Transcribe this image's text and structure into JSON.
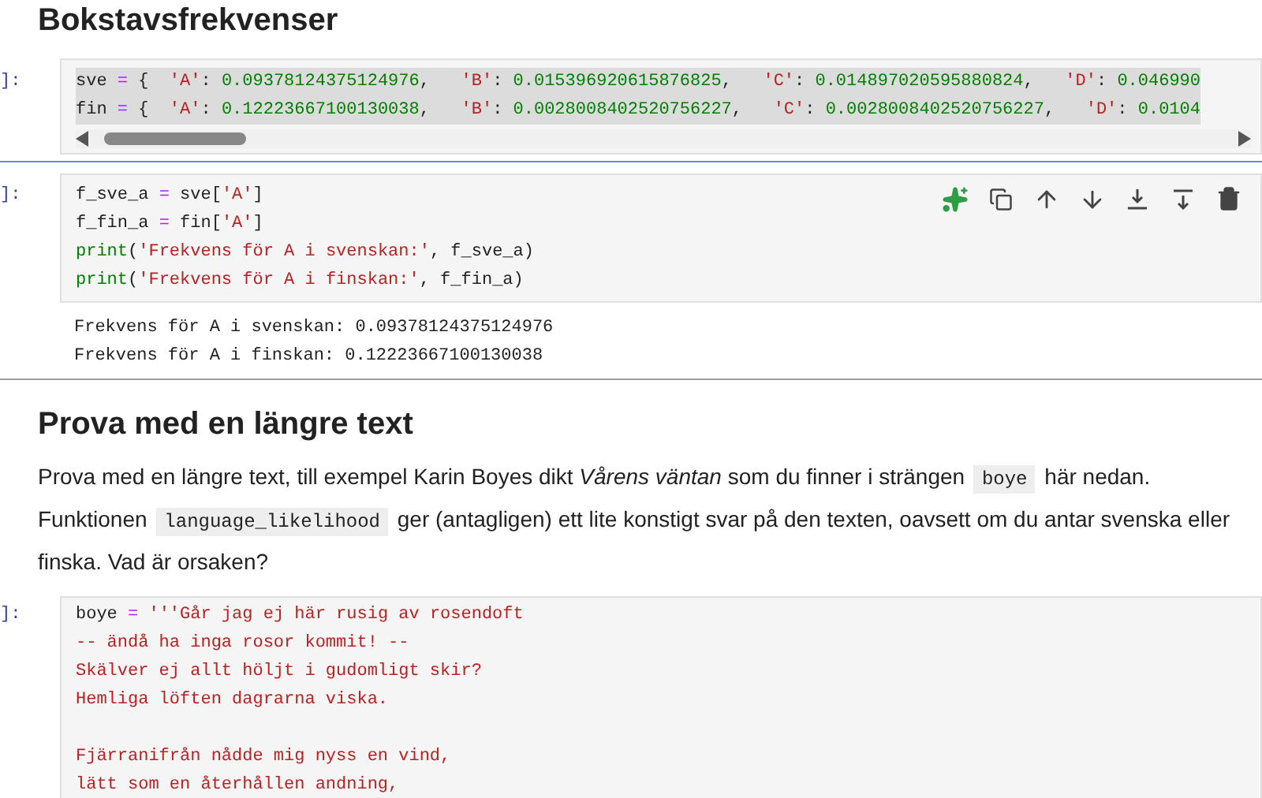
{
  "cells": [
    {
      "kind": "heading",
      "text": "Bokstavsfrekvenser"
    },
    {
      "kind": "code",
      "prompt": "]:",
      "active": false,
      "scrollbar": true,
      "lines": [
        {
          "highlighted": true,
          "tokens": [
            {
              "kind": "name",
              "s": "sve "
            },
            {
              "kind": "op",
              "s": "="
            },
            {
              "kind": "punct",
              "s": " {  "
            },
            {
              "kind": "str",
              "s": "'A'"
            },
            {
              "kind": "name",
              "s": ": "
            },
            {
              "kind": "num",
              "s": "0.09378124375124976"
            },
            {
              "kind": "name",
              "s": ",   "
            },
            {
              "kind": "str",
              "s": "'B'"
            },
            {
              "kind": "name",
              "s": ": "
            },
            {
              "kind": "num",
              "s": "0.015396920615876825"
            },
            {
              "kind": "name",
              "s": ",   "
            },
            {
              "kind": "str",
              "s": "'C'"
            },
            {
              "kind": "name",
              "s": ": "
            },
            {
              "kind": "num",
              "s": "0.014897020595880824"
            },
            {
              "kind": "name",
              "s": ",   "
            },
            {
              "kind": "str",
              "s": "'D'"
            },
            {
              "kind": "name",
              "s": ": "
            },
            {
              "kind": "num",
              "s": "0.046990"
            }
          ]
        },
        {
          "highlighted": true,
          "tokens": [
            {
              "kind": "name",
              "s": "fin "
            },
            {
              "kind": "op",
              "s": "="
            },
            {
              "kind": "punct",
              "s": " {  "
            },
            {
              "kind": "str",
              "s": "'A'"
            },
            {
              "kind": "name",
              "s": ": "
            },
            {
              "kind": "num",
              "s": "0.12223667100130038"
            },
            {
              "kind": "name",
              "s": ",   "
            },
            {
              "kind": "str",
              "s": "'B'"
            },
            {
              "kind": "name",
              "s": ": "
            },
            {
              "kind": "num",
              "s": "0.0028008402520756227"
            },
            {
              "kind": "name",
              "s": ",   "
            },
            {
              "kind": "str",
              "s": "'C'"
            },
            {
              "kind": "name",
              "s": ": "
            },
            {
              "kind": "num",
              "s": "0.0028008402520756227"
            },
            {
              "kind": "name",
              "s": ",   "
            },
            {
              "kind": "str",
              "s": "'D'"
            },
            {
              "kind": "name",
              "s": ": "
            },
            {
              "kind": "num",
              "s": "0.0104"
            }
          ]
        }
      ]
    },
    {
      "kind": "code",
      "prompt": "]:",
      "active": true,
      "scrollbar": false,
      "lines": [
        {
          "highlighted": false,
          "tokens": [
            {
              "kind": "name",
              "s": "f_sve_a "
            },
            {
              "kind": "op",
              "s": "="
            },
            {
              "kind": "name",
              "s": " sve["
            },
            {
              "kind": "str",
              "s": "'A'"
            },
            {
              "kind": "name",
              "s": "]"
            }
          ]
        },
        {
          "highlighted": false,
          "tokens": [
            {
              "kind": "name",
              "s": "f_fin_a "
            },
            {
              "kind": "op",
              "s": "="
            },
            {
              "kind": "name",
              "s": " fin["
            },
            {
              "kind": "str",
              "s": "'A'"
            },
            {
              "kind": "name",
              "s": "]"
            }
          ]
        },
        {
          "highlighted": false,
          "tokens": [
            {
              "kind": "builtin",
              "s": "print"
            },
            {
              "kind": "name",
              "s": "("
            },
            {
              "kind": "str",
              "s": "'Frekvens för A i svenskan:'"
            },
            {
              "kind": "name",
              "s": ", f_sve_a)"
            }
          ]
        },
        {
          "highlighted": false,
          "tokens": [
            {
              "kind": "builtin",
              "s": "print"
            },
            {
              "kind": "name",
              "s": "("
            },
            {
              "kind": "str",
              "s": "'Frekvens för A i finskan:'"
            },
            {
              "kind": "name",
              "s": ", f_fin_a)"
            }
          ]
        }
      ],
      "outputs": [
        "Frekvens för A i svenskan: 0.09378124375124976",
        "Frekvens för A i finskan: 0.12223667100130038"
      ]
    },
    {
      "kind": "heading",
      "text": "Prova med en längre text"
    },
    {
      "kind": "paragraph",
      "segments": [
        {
          "kind": "text",
          "text": "Prova med en längre text, till exempel Karin Boyes dikt *Vårens väntan* som du finner i strängen "
        },
        {
          "kind": "code",
          "text": "boye"
        },
        {
          "kind": "text",
          "text": " här nedan. Funktionen "
        },
        {
          "kind": "code",
          "text": "language_likelihood"
        },
        {
          "kind": "text",
          "text": " ger (antagligen) ett lite konstigt svar på den texten, oavsett om du antar svenska eller finska. Vad är orsaken?"
        }
      ]
    },
    {
      "kind": "code",
      "prompt": "]:",
      "active": false,
      "scrollbar": false,
      "lines": [
        {
          "highlighted": false,
          "tokens": [
            {
              "kind": "name",
              "s": "boye "
            },
            {
              "kind": "op",
              "s": "="
            },
            {
              "kind": "str",
              "s": " '''Går jag ej här rusig av rosendoft"
            }
          ]
        },
        {
          "highlighted": false,
          "tokens": [
            {
              "kind": "str",
              "s": "-- ändå ha inga rosor kommit! --"
            }
          ]
        },
        {
          "highlighted": false,
          "tokens": [
            {
              "kind": "str",
              "s": "Skälver ej allt höljt i gudomligt skir?"
            }
          ]
        },
        {
          "highlighted": false,
          "tokens": [
            {
              "kind": "str",
              "s": "Hemliga löften dagrarna viska."
            }
          ]
        },
        {
          "highlighted": false
        },
        {
          "highlighted": false,
          "tokens": [
            {
              "kind": "str",
              "s": "Fjärranifrån nådde mig nyss en vind,"
            }
          ]
        },
        {
          "highlighted": false,
          "tokens": [
            {
              "kind": "str",
              "s": "lätt som en återhållen andning,"
            }
          ]
        }
      ]
    }
  ]
}
